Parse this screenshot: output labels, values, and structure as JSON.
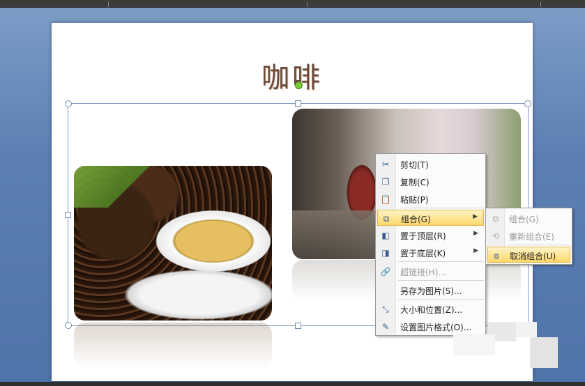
{
  "slide": {
    "title": "咖啡"
  },
  "context_menu": {
    "items": [
      {
        "label": "剪切(T)",
        "icon": "scissors-icon",
        "enabled": true
      },
      {
        "label": "复制(C)",
        "icon": "copy-icon",
        "enabled": true
      },
      {
        "label": "粘贴(P)",
        "icon": "paste-icon",
        "enabled": true
      },
      {
        "label": "组合(G)",
        "icon": "group-icon",
        "enabled": true,
        "submenu": true,
        "highlighted": true
      },
      {
        "label": "置于顶层(R)",
        "icon": "bring-to-front-icon",
        "enabled": true,
        "submenu": true
      },
      {
        "label": "置于底层(K)",
        "icon": "send-to-back-icon",
        "enabled": true,
        "submenu": true
      },
      {
        "label": "超链接(H)...",
        "icon": "hyperlink-icon",
        "enabled": false
      },
      {
        "label": "另存为图片(S)...",
        "icon": "",
        "enabled": true
      },
      {
        "label": "大小和位置(Z)...",
        "icon": "size-position-icon",
        "enabled": true
      },
      {
        "label": "设置图片格式(O)...",
        "icon": "format-picture-icon",
        "enabled": true
      }
    ]
  },
  "submenu": {
    "items": [
      {
        "label": "组合(G)",
        "icon": "group-icon",
        "enabled": false
      },
      {
        "label": "重新组合(E)",
        "icon": "regroup-icon",
        "enabled": false
      },
      {
        "label": "取消组合(U)",
        "icon": "ungroup-icon",
        "enabled": true,
        "highlighted": true
      }
    ]
  },
  "colors": {
    "highlight": "#ffd86b",
    "selection_frame": "#7d9ec0",
    "rotation_handle": "#7acb35"
  }
}
